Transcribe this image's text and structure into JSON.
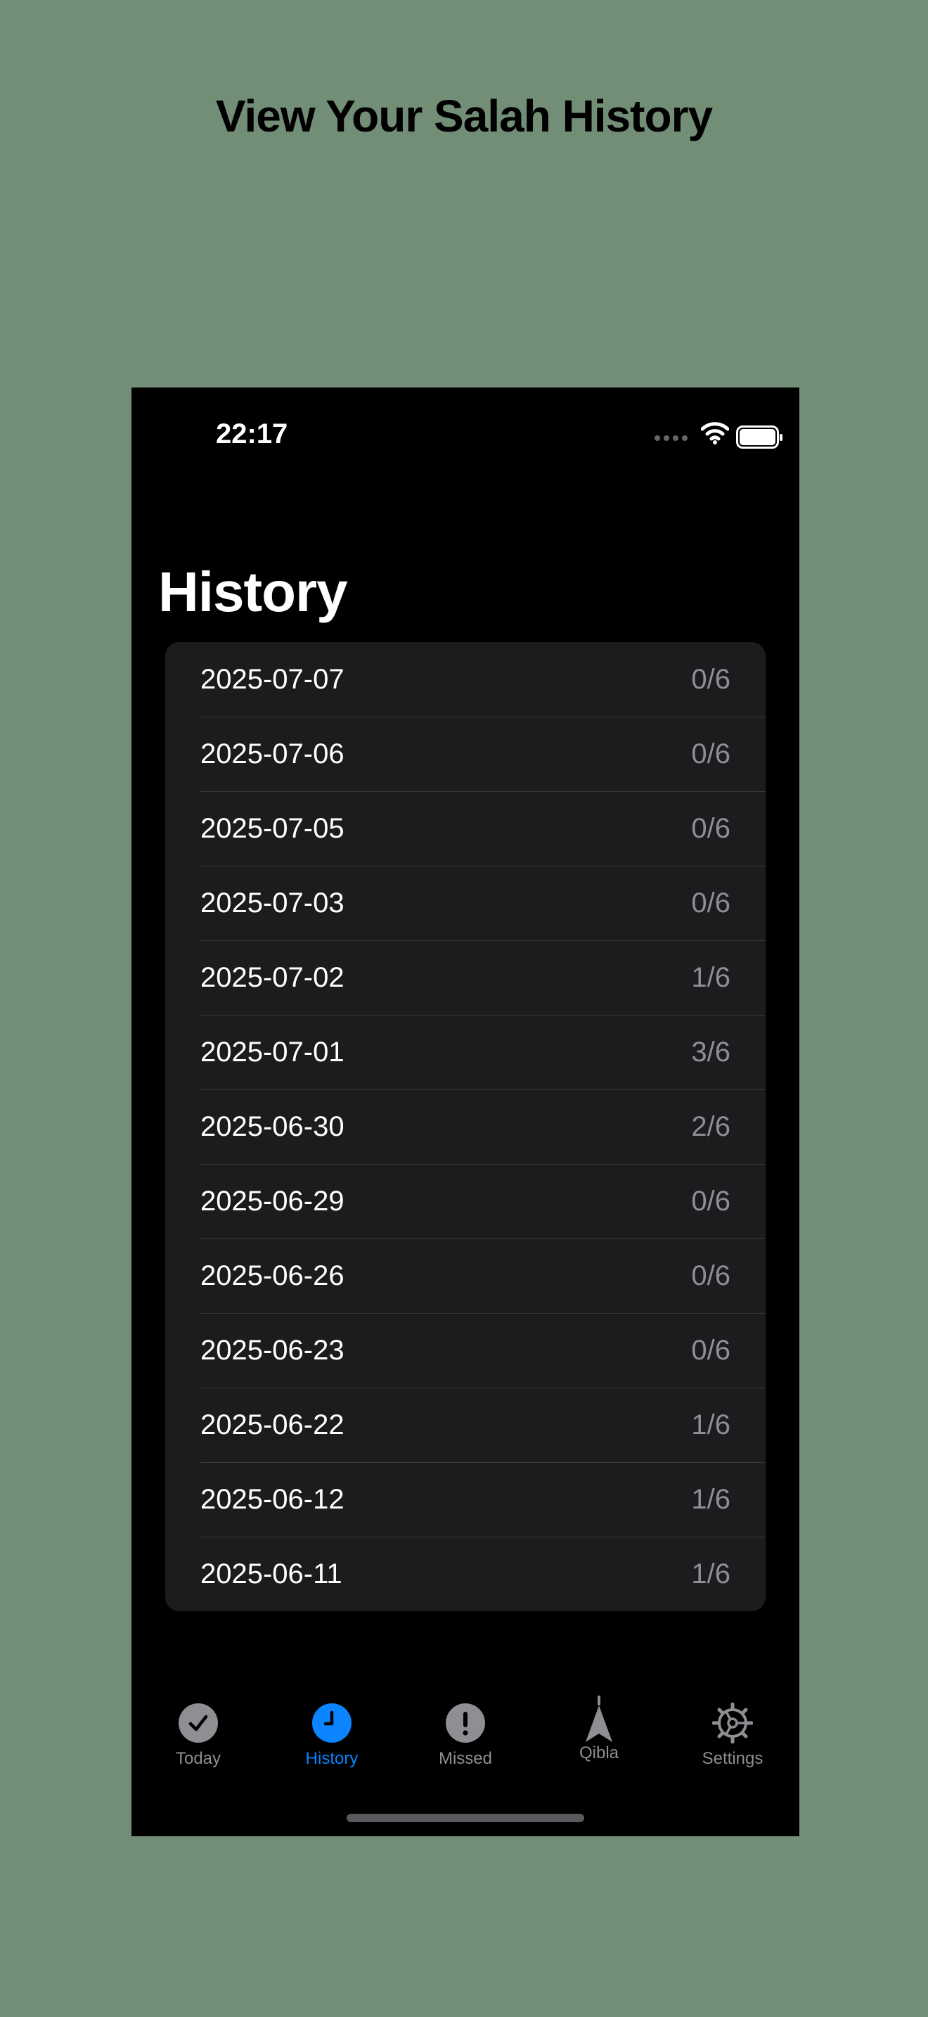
{
  "headline": "View Your Salah History",
  "status_bar": {
    "time": "22:17"
  },
  "page_title": "History",
  "history": [
    {
      "date": "2025-07-07",
      "count": "0/6"
    },
    {
      "date": "2025-07-06",
      "count": "0/6"
    },
    {
      "date": "2025-07-05",
      "count": "0/6"
    },
    {
      "date": "2025-07-03",
      "count": "0/6"
    },
    {
      "date": "2025-07-02",
      "count": "1/6"
    },
    {
      "date": "2025-07-01",
      "count": "3/6"
    },
    {
      "date": "2025-06-30",
      "count": "2/6"
    },
    {
      "date": "2025-06-29",
      "count": "0/6"
    },
    {
      "date": "2025-06-26",
      "count": "0/6"
    },
    {
      "date": "2025-06-23",
      "count": "0/6"
    },
    {
      "date": "2025-06-22",
      "count": "1/6"
    },
    {
      "date": "2025-06-12",
      "count": "1/6"
    },
    {
      "date": "2025-06-11",
      "count": "1/6"
    }
  ],
  "tabs": [
    {
      "label": "Today",
      "icon": "checkmark-circle-icon",
      "active": false
    },
    {
      "label": "History",
      "icon": "clock-icon",
      "active": true
    },
    {
      "label": "Missed",
      "icon": "exclamation-circle-icon",
      "active": false
    },
    {
      "label": "Qibla",
      "icon": "compass-arrow-icon",
      "active": false
    },
    {
      "label": "Settings",
      "icon": "gear-icon",
      "active": false
    }
  ],
  "colors": {
    "background": "#738e76",
    "accent": "#0a84ff",
    "inactive": "#8e8e93",
    "list_background": "#1c1c1e"
  }
}
